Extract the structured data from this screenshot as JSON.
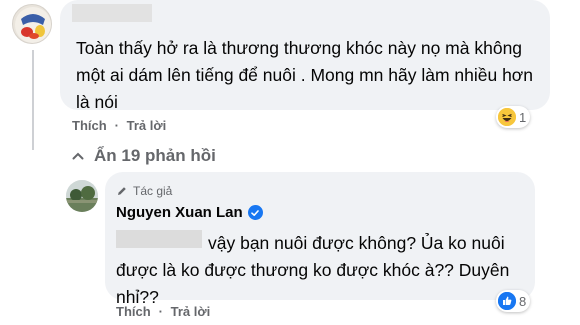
{
  "comment1": {
    "text": "Toàn thấy hở ra là thương thương khóc này nọ mà không một ai dám lên tiếng để nuôi . Mong mn hãy làm nhiều hơn là nói",
    "actions": {
      "like": "Thích",
      "reply": "Trả lời"
    },
    "reactions": {
      "icon": "haha-icon",
      "count": "1"
    }
  },
  "hide_replies": {
    "label": "Ẩn 19 phản hồi"
  },
  "reply": {
    "author_badge": "Tác giả",
    "author_name": "Nguyen Xuan Lan",
    "text": "vậy bạn nuôi được không? Ủa ko nuôi được là ko được thương ko được khóc à?? Duyên nhỉ??",
    "actions": {
      "like": "Thích",
      "reply": "Trả lời"
    },
    "reactions": {
      "icon": "like-icon",
      "count": "8"
    }
  },
  "colors": {
    "bubble": "#f0f2f5",
    "meta_text": "#65676b",
    "verified": "#1877f2"
  }
}
